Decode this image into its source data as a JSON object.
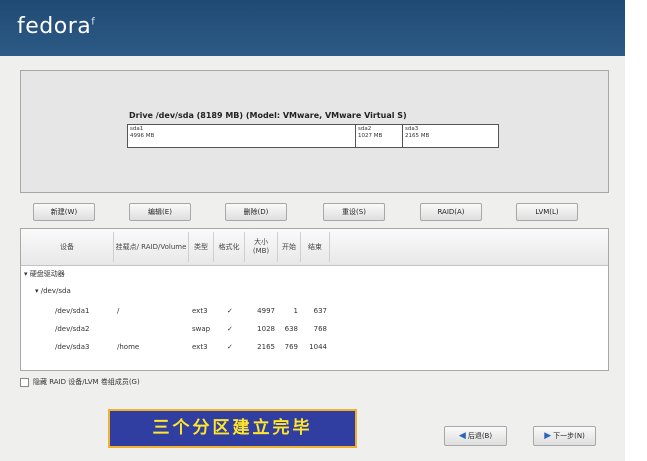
{
  "app": {
    "logo": "fedora",
    "logo_mark": "f"
  },
  "drive": {
    "title": "Drive /dev/sda (8189 MB) (Model: VMware, VMware Virtual S)",
    "segments": [
      {
        "name": "sda1",
        "size": "4996 MB"
      },
      {
        "name": "sda2",
        "size": "1027 MB"
      },
      {
        "name": "sda3",
        "size": "2165 MB"
      }
    ]
  },
  "buttons": {
    "new": "新建(W)",
    "edit": "编辑(E)",
    "delete": "删除(D)",
    "reset": "重设(S)",
    "raid": "RAID(A)",
    "lvm": "LVM(L)"
  },
  "columns": {
    "device": "设备",
    "mount": "挂载点/ RAID/Volume",
    "type": "类型",
    "format": "格式化",
    "size": "大小 (MB)",
    "start": "开始",
    "end": "结束"
  },
  "tree": {
    "group": "硬盘驱动器",
    "disk": "/dev/sda",
    "rows": [
      {
        "device": "/dev/sda1",
        "mount": "/",
        "type": "ext3",
        "format": "✓",
        "size": "4997",
        "start": "1",
        "end": "637"
      },
      {
        "device": "/dev/sda2",
        "mount": "",
        "type": "swap",
        "format": "✓",
        "size": "1028",
        "start": "638",
        "end": "768"
      },
      {
        "device": "/dev/sda3",
        "mount": "/home",
        "type": "ext3",
        "format": "✓",
        "size": "2165",
        "start": "769",
        "end": "1044"
      }
    ]
  },
  "options": {
    "hide_raid": "隐藏 RAID 设备/LVM 卷组成员(G)"
  },
  "caption": "三个分区建立完毕",
  "nav": {
    "back": "后退(B)",
    "next": "下一步(N)"
  },
  "colors": {
    "banner": "#1f4a74",
    "caption_bg": "#2f3ea0",
    "caption_text": "#ffe52b",
    "caption_border": "#f0b030"
  }
}
